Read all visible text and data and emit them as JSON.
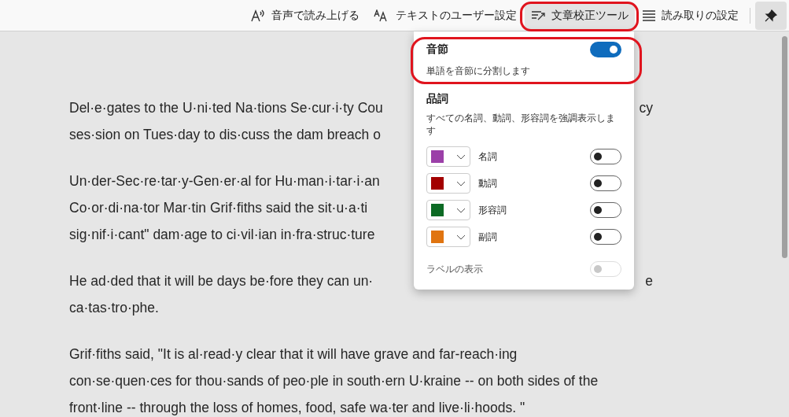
{
  "toolbar": {
    "items": [
      {
        "kind": "read_aloud",
        "label": "音声で読み上げる",
        "selected": false
      },
      {
        "kind": "text_prefs",
        "label": "テキストのユーザー設定",
        "selected": false
      },
      {
        "kind": "grammar",
        "label": "文章校正ツール",
        "selected": true
      },
      {
        "kind": "reading",
        "label": "読み取りの設定",
        "selected": false
      }
    ]
  },
  "article": {
    "paragraphs": [
      {
        "lines": [
          {
            "text": "Del·e·gates to the U·ni·ted Na·tions Se·cur·i·ty Cou",
            "right_text": "cy"
          },
          {
            "text": "ses·sion on Tues·day to dis·cuss the dam breach o"
          }
        ]
      },
      {
        "lines": [
          {
            "text": "Un·der-Sec·re·tar·y-Gen·er·al for Hu·man·i·tar·i·an"
          },
          {
            "text": "Co·or·di·na·tor Mar·tin Grif·fiths said the sit·u·a·ti"
          },
          {
            "text": "sig·nif·i·cant\" dam·age to ci·vil·ian in·fra·struc·ture"
          }
        ]
      },
      {
        "lines": [
          {
            "text": "He ad·ded that it will be days be·fore they can un·",
            "right_text": "e"
          },
          {
            "text": "ca·tas·tro·phe."
          }
        ]
      },
      {
        "lines": [
          {
            "text": "Grif·fiths said, \"It is al·read·y clear that it will have grave and far-reach·ing"
          },
          {
            "text": "con·se·quen·ces for thou·sands of peo·ple in south·ern U·kraine -- on both sides of the"
          },
          {
            "text": "front·line -- through the loss of homes, food, safe wa·ter and live·li·hoods. \""
          }
        ]
      }
    ]
  },
  "grammar_panel": {
    "syllables": {
      "title": "音節",
      "description": "単語を音節に分割します",
      "on": true
    },
    "parts_of_speech": {
      "title": "品詞",
      "description": "すべての名詞、動詞、形容詞を強調表示します",
      "items": [
        {
          "label": "名詞",
          "color": "#9b3fa8",
          "on": false
        },
        {
          "label": "動詞",
          "color": "#a30000",
          "on": false
        },
        {
          "label": "形容詞",
          "color": "#0c6a24",
          "on": false
        },
        {
          "label": "副詞",
          "color": "#e07410",
          "on": false
        }
      ]
    },
    "show_labels": {
      "label": "ラベルの表示",
      "on": false,
      "disabled": true
    }
  }
}
